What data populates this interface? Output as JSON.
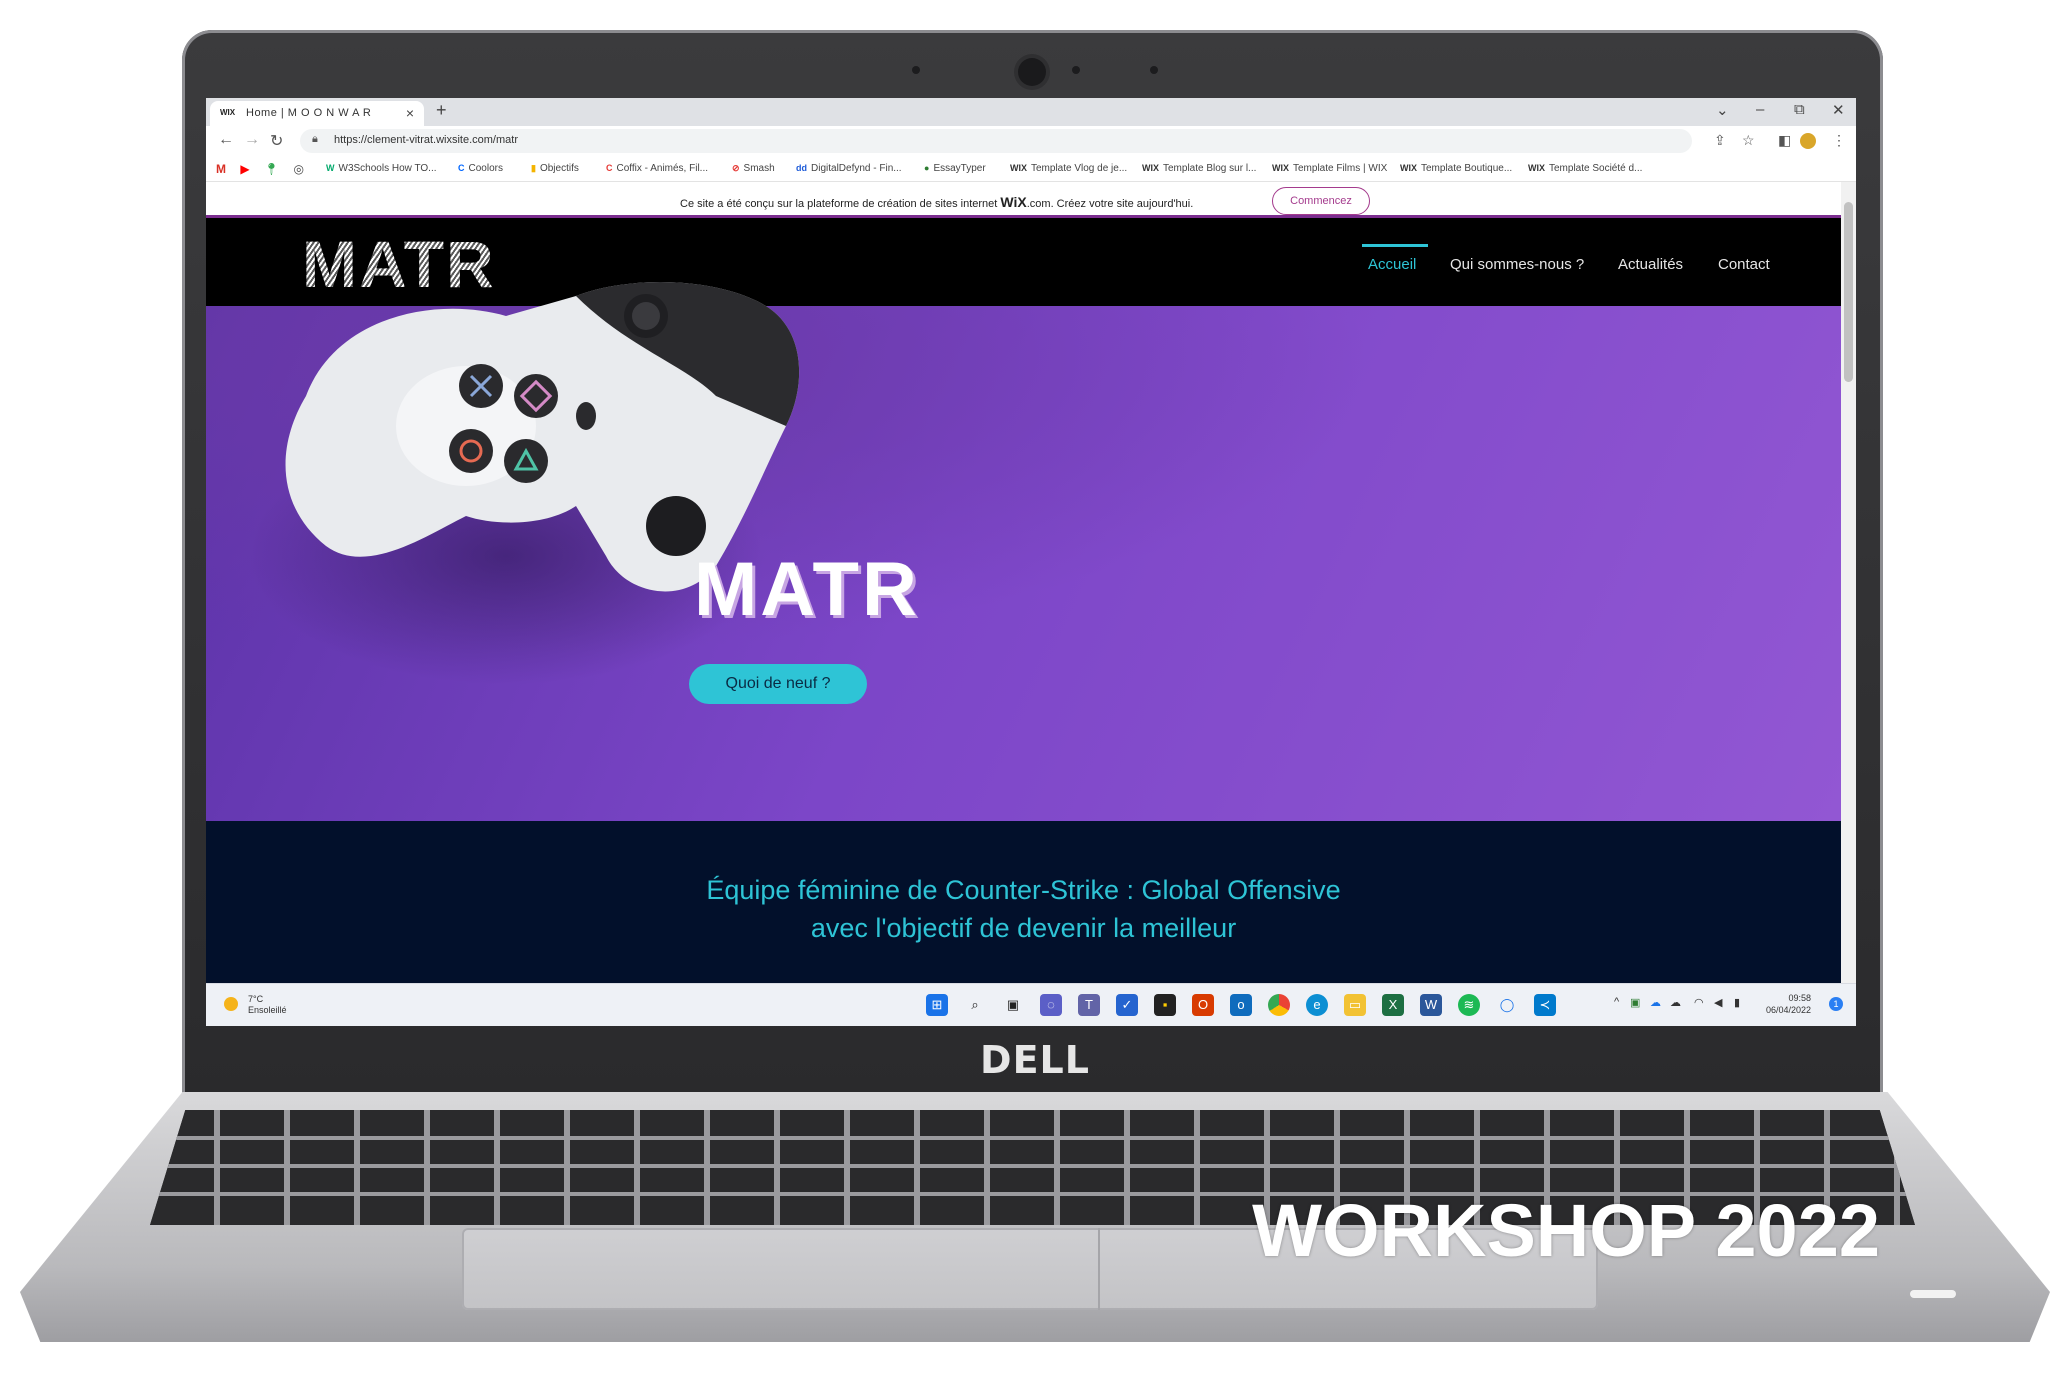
{
  "browser": {
    "tab_title": "Home | M O O N  W A R",
    "tab_favicon": "WIX",
    "new_tab": "+",
    "close_tab": "×",
    "minimize": "–",
    "restore": "⧉",
    "close_window": "✕",
    "chevron": "⌄",
    "url": "https://clement-vitrat.wixsite.com/matr",
    "bookmarks": [
      "W3Schools How TO...",
      "Coolors",
      "Objectifs",
      "Coffix - Animés, Fil...",
      "Smash",
      "DigitalDefynd - Fin...",
      "EssayTyper",
      "Template Vlog de je...",
      "Template Blog sur l...",
      "Template Films | WIX",
      "Template Boutique...",
      "Template Société d..."
    ]
  },
  "wix_banner": {
    "message_before": "Ce site a été conçu sur la plateforme de création de sites internet ",
    "brand": "WiX",
    "message_after": ".com. Créez votre site aujourd'hui.",
    "cta": "Commencez"
  },
  "site": {
    "logo": "MATR",
    "menu": [
      "Accueil",
      "Qui sommes-nous ?",
      "Actualités",
      "Contact"
    ],
    "hero_title": "MATR",
    "hero_button": "Quoi de neuf ?",
    "tagline_line1": "Équipe féminine de Counter-Strike : Global Offensive",
    "tagline_line2": "avec l'objectif de devenir la meilleur"
  },
  "taskbar": {
    "temperature": "7°C",
    "weather": "Ensoleillé",
    "time": "09:58",
    "date": "06/04/2022"
  },
  "laptop": {
    "brand": "DELL",
    "overlay_text": "WORKSHOP 2022"
  },
  "colors": {
    "accent": "#2ec4d6",
    "hero_purple": "#7c46c8",
    "dark_section": "#02102b",
    "wix_pink": "#a43b8d"
  },
  "icons": [
    "back-icon",
    "forward-icon",
    "reload-icon",
    "lock-icon",
    "share-icon",
    "star-icon",
    "sidepanel-icon",
    "profile-icon",
    "menu-dots-icon",
    "windows-start-icon",
    "search-icon",
    "task-view-icon",
    "chat-icon",
    "teams-icon",
    "todo-icon",
    "sticky-notes-icon",
    "office-icon",
    "outlook-icon",
    "chrome-icon",
    "edge-icon",
    "file-explorer-icon",
    "excel-icon",
    "word-icon",
    "spotify-icon",
    "maps-icon",
    "vscode-icon"
  ]
}
